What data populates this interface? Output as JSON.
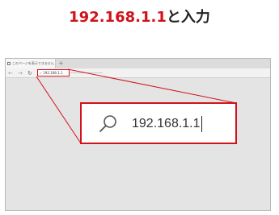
{
  "caption": {
    "highlight": "192.168.1.1",
    "rest": "と入力"
  },
  "browser": {
    "tab_title": "このページを表示できません",
    "tab_close": "×",
    "new_tab": "+",
    "nav_back": "←",
    "nav_forward": "→",
    "nav_reload": "↻",
    "address_value": "192.168.1.1"
  },
  "zoom": {
    "address_value": "192.168.1.1",
    "icon": "search-icon"
  },
  "colors": {
    "accent_red": "#d0121b"
  }
}
